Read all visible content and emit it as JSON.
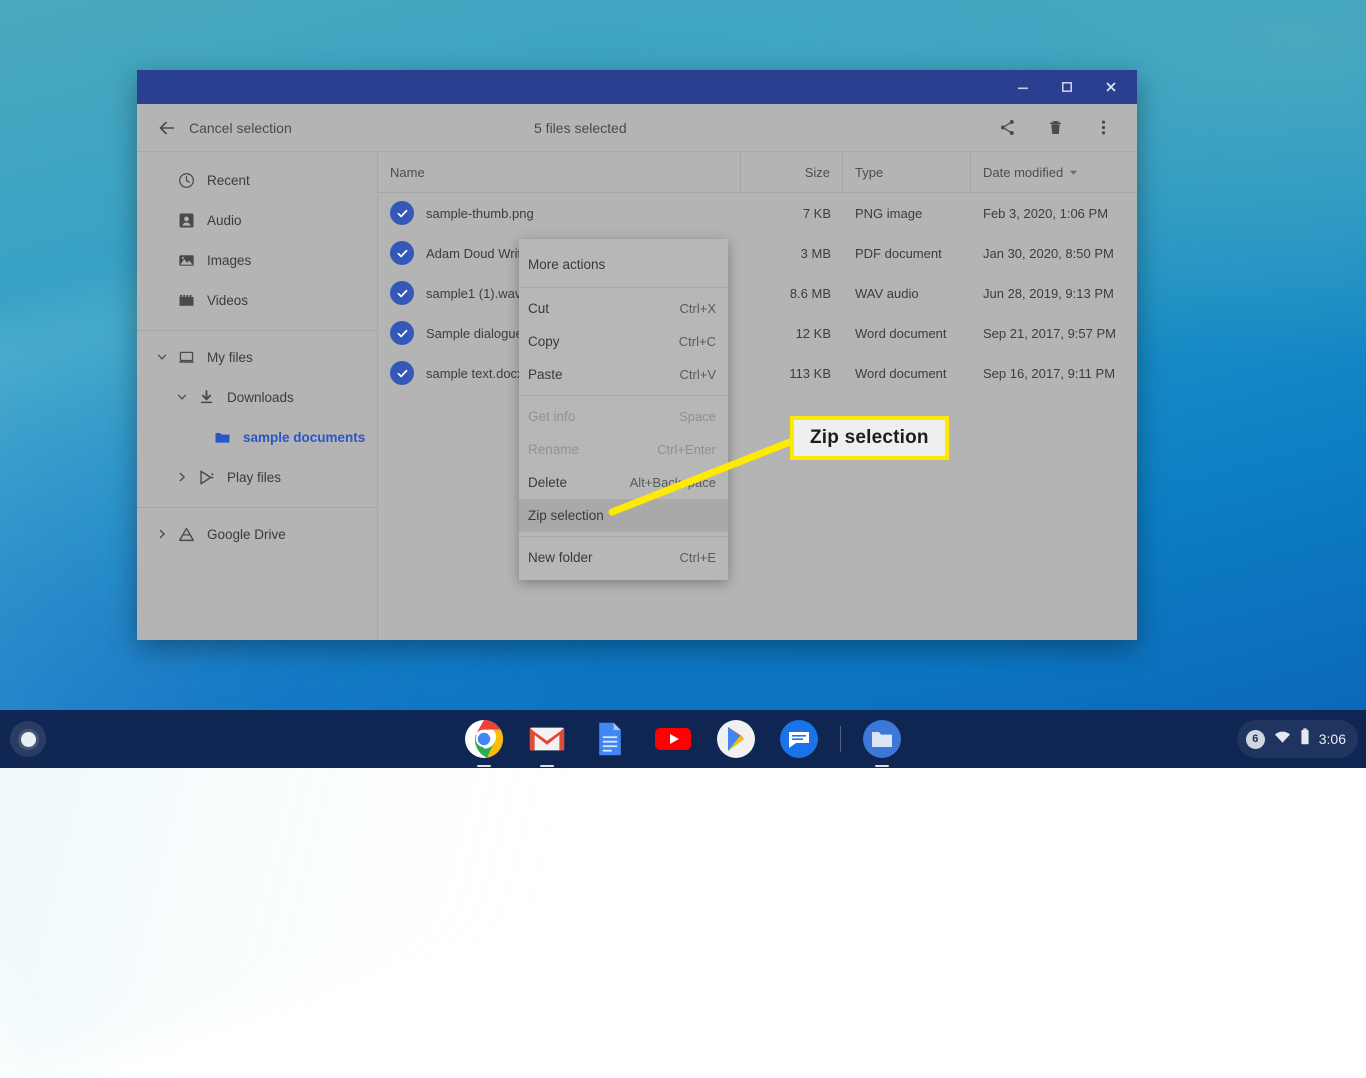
{
  "window": {
    "title_controls": [
      {
        "name": "minimize",
        "label": "Minimize"
      },
      {
        "name": "maximize",
        "label": "Maximize"
      },
      {
        "name": "close",
        "label": "Close"
      }
    ],
    "titlebar_color": "#2a3f8f"
  },
  "toolbar": {
    "back_label": "Cancel selection",
    "selection_count": "5 files selected",
    "actions": [
      {
        "name": "share",
        "label": "Share"
      },
      {
        "name": "delete",
        "label": "Delete"
      },
      {
        "name": "more",
        "label": "More options"
      }
    ]
  },
  "sidebar": {
    "groups": [
      {
        "items": [
          {
            "label": "Recent",
            "icon": "clock-icon",
            "level": 0,
            "twisty": "",
            "selected": false
          },
          {
            "label": "Audio",
            "icon": "audio-icon",
            "level": 0,
            "twisty": "",
            "selected": false
          },
          {
            "label": "Images",
            "icon": "images-icon",
            "level": 0,
            "twisty": "",
            "selected": false
          },
          {
            "label": "Videos",
            "icon": "videos-icon",
            "level": 0,
            "twisty": "",
            "selected": false
          }
        ]
      },
      {
        "items": [
          {
            "label": "My files",
            "icon": "myfiles-icon",
            "level": 0,
            "twisty": "down",
            "selected": false
          },
          {
            "label": "Downloads",
            "icon": "downloads-icon",
            "level": 1,
            "twisty": "down",
            "selected": false
          },
          {
            "label": "sample documents",
            "icon": "folder-icon",
            "level": 2,
            "twisty": "",
            "selected": true
          },
          {
            "label": "Play files",
            "icon": "playfiles-icon",
            "level": 1,
            "twisty": "right",
            "selected": false
          }
        ]
      },
      {
        "items": [
          {
            "label": "Google Drive",
            "icon": "google-drive-icon",
            "level": 0,
            "twisty": "right",
            "selected": false
          }
        ]
      }
    ]
  },
  "file_list": {
    "columns": [
      {
        "key": "name",
        "label": "Name",
        "sorted": false
      },
      {
        "key": "size",
        "label": "Size",
        "sorted": false
      },
      {
        "key": "type",
        "label": "Type",
        "sorted": false
      },
      {
        "key": "date",
        "label": "Date modified",
        "sorted": true,
        "sort_direction": "desc"
      }
    ],
    "rows": [
      {
        "name": "sample-thumb.png",
        "size": "7 KB",
        "type": "PNG image",
        "date": "Feb 3, 2020, 1:06 PM",
        "selected": true
      },
      {
        "name": "Adam Doud Writing",
        "size": "3 MB",
        "type": "PDF document",
        "date": "Jan 30, 2020, 8:50 PM",
        "selected": true
      },
      {
        "name": "sample1 (1).wav",
        "size": "8.6 MB",
        "type": "WAV audio",
        "date": "Jun 28, 2019, 9:13 PM",
        "selected": true
      },
      {
        "name": "Sample dialogue.",
        "size": "12 KB",
        "type": "Word document",
        "date": "Sep 21, 2017, 9:57 PM",
        "selected": true
      },
      {
        "name": "sample text.docx",
        "size": "113 KB",
        "type": "Word document",
        "date": "Sep 16, 2017, 9:11 PM",
        "selected": true
      }
    ]
  },
  "context_menu": {
    "title": "More actions",
    "items": [
      {
        "label": "Cut",
        "accel": "Ctrl+X",
        "disabled": false,
        "highlight": false,
        "sep_before": true
      },
      {
        "label": "Copy",
        "accel": "Ctrl+C",
        "disabled": false,
        "highlight": false,
        "sep_before": false
      },
      {
        "label": "Paste",
        "accel": "Ctrl+V",
        "disabled": false,
        "highlight": false,
        "sep_before": false
      },
      {
        "label": "Get info",
        "accel": "Space",
        "disabled": true,
        "highlight": false,
        "sep_before": true
      },
      {
        "label": "Rename",
        "accel": "Ctrl+Enter",
        "disabled": true,
        "highlight": false,
        "sep_before": false
      },
      {
        "label": "Delete",
        "accel": "Alt+Backspace",
        "disabled": false,
        "highlight": false,
        "sep_before": false
      },
      {
        "label": "Zip selection",
        "accel": "",
        "disabled": false,
        "highlight": true,
        "sep_before": false
      },
      {
        "label": "New folder",
        "accel": "Ctrl+E",
        "disabled": false,
        "highlight": false,
        "sep_before": true
      }
    ]
  },
  "annotation": {
    "callout_label": "Zip selection",
    "highlight_color": "#ffeb00",
    "box_background": "#efefef"
  },
  "shelf": {
    "launcher_label": "Launcher",
    "apps": [
      {
        "name": "chrome-icon",
        "label": "Google Chrome",
        "running": true
      },
      {
        "name": "gmail-icon",
        "label": "Gmail",
        "running": true
      },
      {
        "name": "docs-icon",
        "label": "Google Docs",
        "running": false
      },
      {
        "name": "youtube-icon",
        "label": "YouTube",
        "running": false
      },
      {
        "name": "playstore-icon",
        "label": "Play Store",
        "running": false
      },
      {
        "name": "messages-icon",
        "label": "Messages",
        "running": false
      },
      {
        "name": "files-icon",
        "label": "Files",
        "running": true
      }
    ],
    "system_tray": {
      "notification_count": "6",
      "wifi_label": "Wi-Fi",
      "battery_label": "Battery",
      "time": "3:06"
    }
  }
}
